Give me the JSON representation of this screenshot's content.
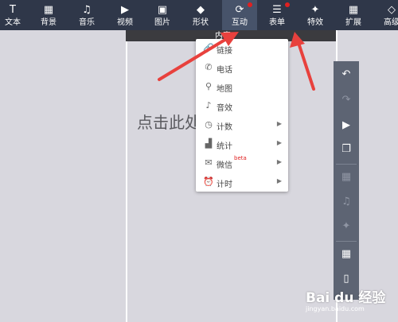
{
  "toolbar": {
    "items": [
      {
        "label": "文本",
        "icon": "text-icon",
        "glyph": "T",
        "active": false
      },
      {
        "label": "背景",
        "icon": "background-grid-icon",
        "glyph": "▦",
        "active": false
      },
      {
        "label": "音乐",
        "icon": "music-icon",
        "glyph": "♫",
        "active": false
      },
      {
        "label": "视频",
        "icon": "video-icon",
        "glyph": "▶",
        "active": false
      },
      {
        "label": "图片",
        "icon": "image-icon",
        "glyph": "▣",
        "active": false
      },
      {
        "label": "形状",
        "icon": "shape-icon",
        "glyph": "◆",
        "active": false
      },
      {
        "label": "互动",
        "icon": "refresh-icon",
        "glyph": "⟳",
        "active": true,
        "dot": true
      },
      {
        "label": "表单",
        "icon": "list-icon",
        "glyph": "☰",
        "active": false,
        "dot": true
      },
      {
        "label": "特效",
        "icon": "sparkle-icon",
        "glyph": "✦",
        "active": false
      },
      {
        "label": "扩展",
        "icon": "apps-icon",
        "glyph": "▦",
        "active": false
      },
      {
        "label": "高级",
        "icon": "diamond-icon",
        "glyph": "◇",
        "active": false
      }
    ]
  },
  "canvas": {
    "header_text": "内容",
    "placeholder": "点击此处"
  },
  "menu": {
    "items": [
      {
        "label": "链接",
        "icon": "link-icon",
        "glyph": "🔗",
        "submenu": false
      },
      {
        "label": "电话",
        "icon": "phone-icon",
        "glyph": "✆",
        "submenu": false
      },
      {
        "label": "地图",
        "icon": "map-pin-icon",
        "glyph": "⚲",
        "submenu": false
      },
      {
        "label": "音效",
        "icon": "sound-icon",
        "glyph": "♪",
        "submenu": false
      },
      {
        "label": "计数",
        "icon": "clock-icon",
        "glyph": "◷",
        "submenu": true
      },
      {
        "label": "统计",
        "icon": "chart-icon",
        "glyph": "▟",
        "submenu": true
      },
      {
        "label": "微信",
        "icon": "wechat-icon",
        "glyph": "✉",
        "submenu": true,
        "badge": "beta"
      },
      {
        "label": "计时",
        "icon": "alarm-icon",
        "glyph": "⏰",
        "submenu": true
      }
    ]
  },
  "sidebar": {
    "buttons": [
      {
        "icon": "undo-icon",
        "glyph": "↶",
        "dim": false
      },
      {
        "icon": "redo-icon",
        "glyph": "↷",
        "dim": true
      },
      {
        "icon": "play-icon",
        "glyph": "▶",
        "dim": false
      },
      {
        "icon": "pages-icon",
        "glyph": "❐",
        "dim": false
      },
      {
        "icon": "grid-icon",
        "glyph": "▦",
        "dim": true
      },
      {
        "icon": "music-icon",
        "glyph": "♫",
        "dim": true
      },
      {
        "icon": "sparkle-icon",
        "glyph": "✦",
        "dim": true
      },
      {
        "icon": "table-icon",
        "glyph": "▦",
        "dim": false
      },
      {
        "icon": "mobile-icon",
        "glyph": "▯",
        "dim": false
      }
    ]
  },
  "watermark": {
    "brand": "Bai du 经验",
    "url": "jingyan.baidu.com"
  },
  "colors": {
    "toolbar_bg": "#2f3749",
    "toolbar_active": "#47536a",
    "annotation_red": "#e8413d",
    "workspace_bg": "#d8d7de",
    "sidebar_bg": "#5d6473"
  }
}
